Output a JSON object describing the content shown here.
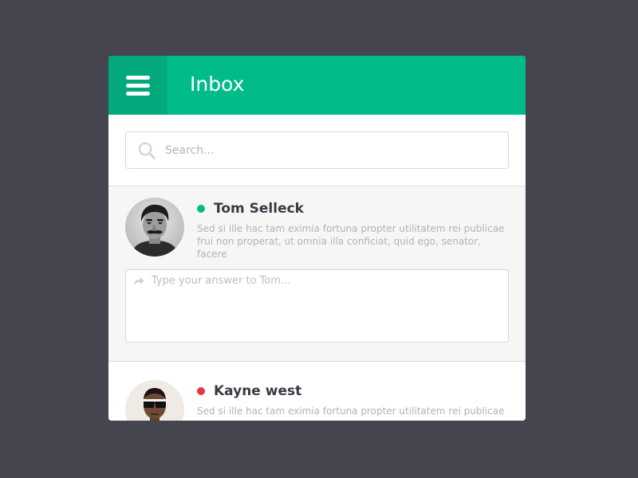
{
  "header": {
    "title": "Inbox",
    "menu_icon": "hamburger-menu-icon",
    "color": "#01bc8a",
    "menu_bg": "#03a97c"
  },
  "search": {
    "placeholder": "Search...",
    "icon": "search-icon"
  },
  "messages": [
    {
      "name": "Tom Selleck",
      "status_color": "#01bc8a",
      "preview": "Sed si ille hac tam eximia fortuna propter utilitatem rei publicae frui non properat, ut omnia illa conficiat, quid ego, senator, facere",
      "reply_placeholder": "Type your answer to Tom...",
      "reply_icon": "reply-arrow-icon",
      "expanded": true
    },
    {
      "name": "Kayne west",
      "status_color": "#e0393f",
      "preview": "Sed si ille hac tam eximia fortuna propter utilitatem rei publicae",
      "expanded": false
    }
  ]
}
